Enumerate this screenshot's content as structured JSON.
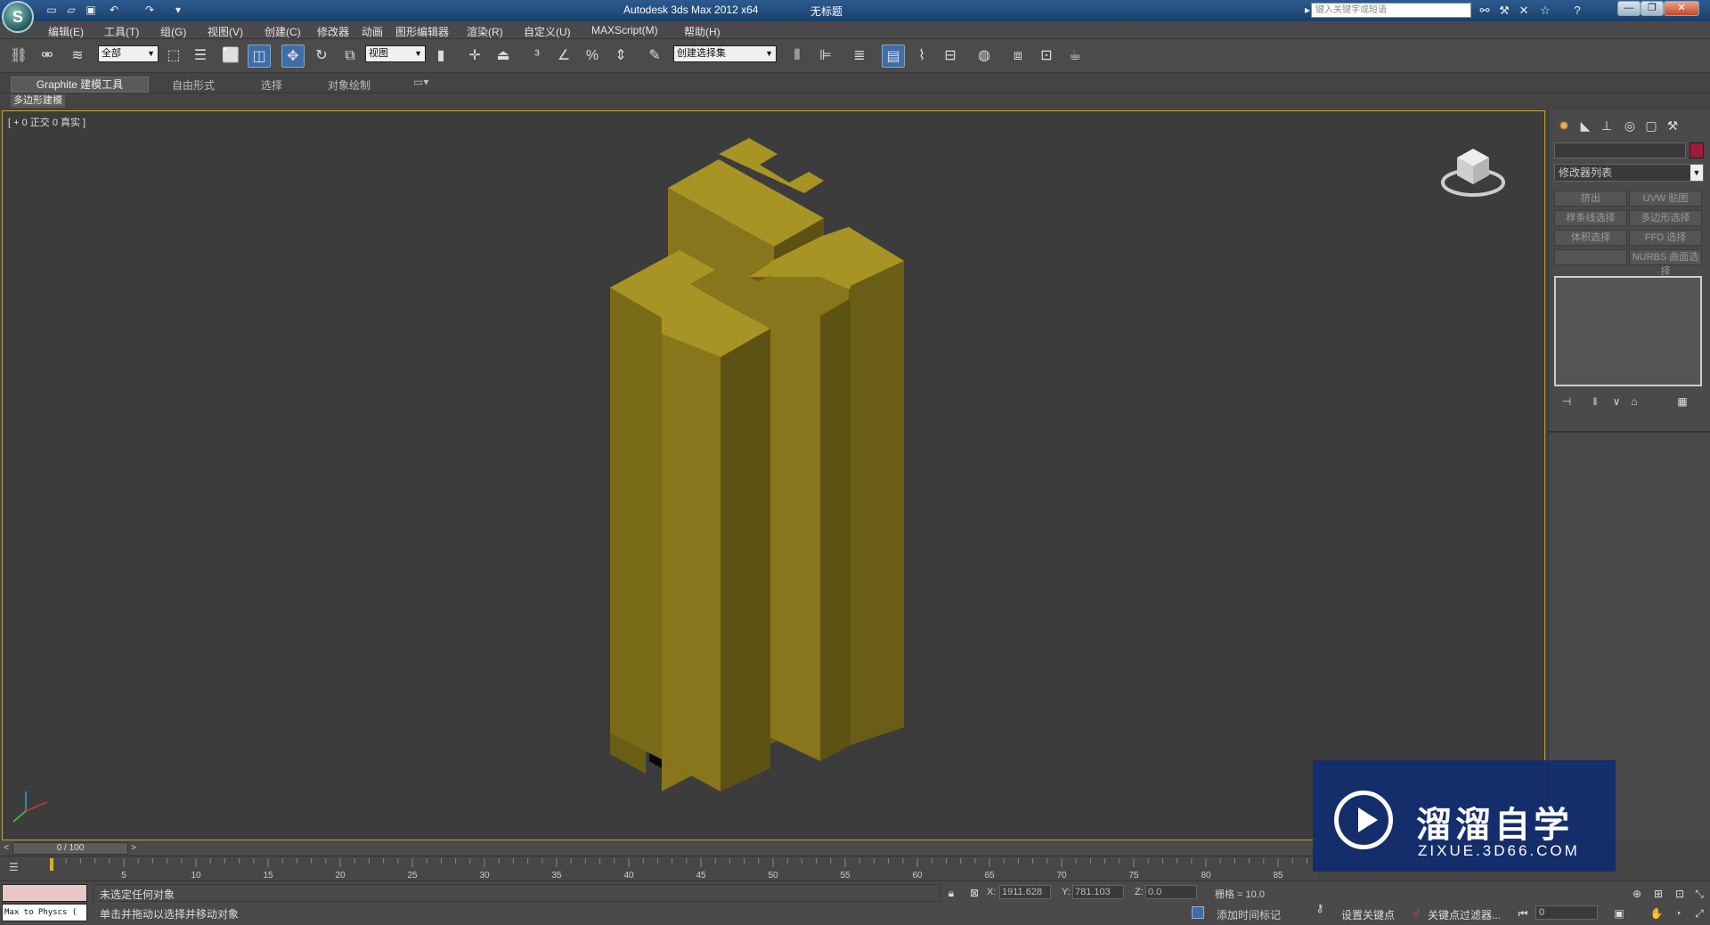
{
  "window": {
    "title": "Autodesk 3ds Max  2012 x64",
    "document": "无标题",
    "search_placeholder": "键入关键字或短语",
    "controls": [
      "—",
      "❐",
      "✕"
    ]
  },
  "menu": [
    "编辑(E)",
    "工具(T)",
    "组(G)",
    "视图(V)",
    "创建(C)",
    "修改器",
    "动画",
    "图形编辑器",
    "渲染(R)",
    "自定义(U)",
    "MAXScript(M)",
    "帮助(H)"
  ],
  "toolbar": {
    "selection_filter": "全部",
    "ref_coord": "视图",
    "named_selection": "创建选择集"
  },
  "ribbon": {
    "tabs": [
      "Graphite 建模工具",
      "自由形式",
      "选择",
      "对象绘制"
    ],
    "subtab": "多边形建模"
  },
  "viewport": {
    "label": "[ + 0 正交 0 真实 ]",
    "object_color": "#8a7a1a"
  },
  "command_panel": {
    "modifier_list": "修改器列表",
    "object_color": "#a01a3c",
    "buttons": [
      "挤出",
      "UVW 贴图",
      "样条线选择",
      "多边形选择",
      "体积选择",
      "FFD 选择",
      "",
      "NURBS 曲面选择"
    ]
  },
  "timeline": {
    "slider_text": "0 / 100",
    "ticks": [
      "5",
      "10",
      "15",
      "20",
      "25",
      "30",
      "35",
      "40",
      "45",
      "50",
      "55",
      "60",
      "65",
      "70",
      "75",
      "80",
      "85"
    ]
  },
  "status": {
    "maxscript_text": "Max to Physcs (",
    "message1": "未选定任何对象",
    "message2": "单击并拖动以选择并移动对象",
    "x_label": "X:",
    "x_value": "1911.628",
    "y_label": "Y:",
    "y_value": "781.103",
    "z_label": "Z:",
    "z_value": "0.0",
    "grid": "栅格 = 10.0",
    "time_tag": "添加时间标记",
    "set_key": "设置关键点",
    "key_filter": "关键点过滤器...",
    "frame": "0"
  },
  "watermark": {
    "title": "溜溜自学",
    "subtitle": "ZIXUE.3D66.COM"
  }
}
